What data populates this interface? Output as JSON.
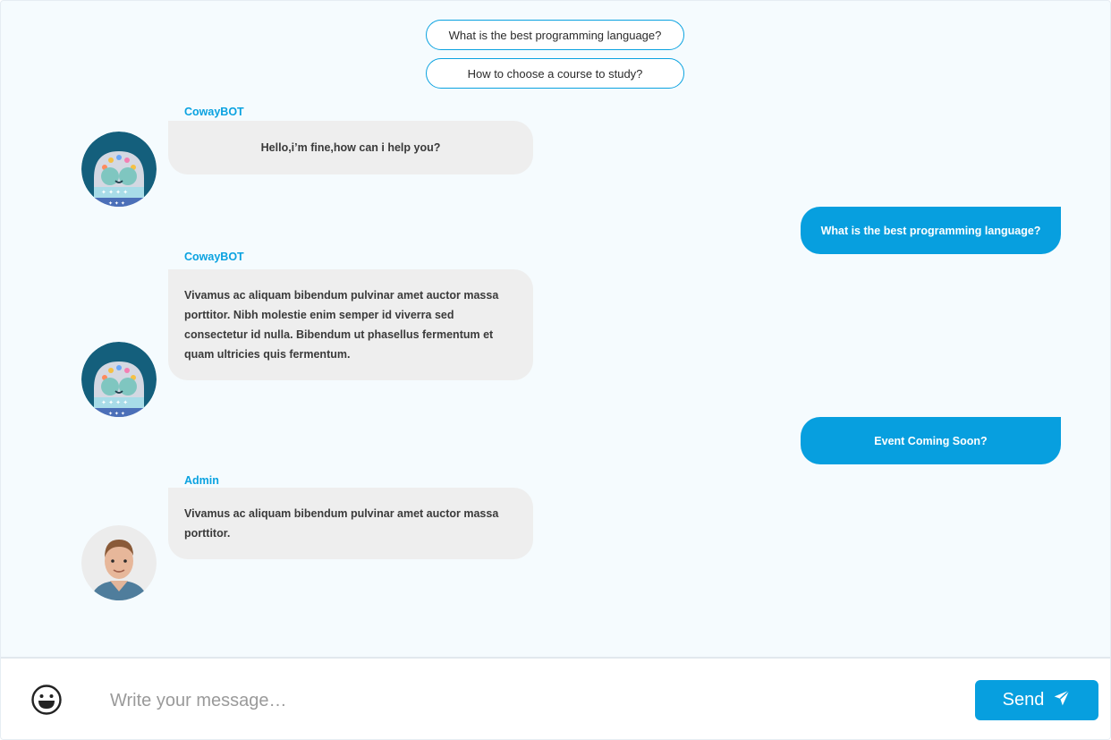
{
  "suggestions": [
    "What is the best programming language?",
    "How to choose a course to study?"
  ],
  "messages": [
    {
      "sender": "CowayBOT",
      "text": "Hello,i’m fine,how can i help you?"
    },
    {
      "text": "What is the best programming language?"
    },
    {
      "sender": "CowayBOT",
      "text": "Vivamus ac aliquam bibendum pulvinar amet auctor massa porttitor. Nibh molestie enim semper id viverra sed consectetur id nulla. Bibendum ut phasellus fermentum et quam ultricies quis fermentum."
    },
    {
      "text": "Event Coming Soon?"
    },
    {
      "sender": "Admin",
      "text": "Vivamus ac aliquam bibendum pulvinar amet auctor massa porttitor."
    }
  ],
  "composer": {
    "placeholder": "Write your message…",
    "send_label": "Send",
    "emoji_icon": "smiley-icon",
    "send_icon": "paper-plane-icon"
  },
  "colors": {
    "accent": "#079fdf",
    "incoming_bubble": "#eeeeee",
    "background": "#f5fbfe"
  }
}
